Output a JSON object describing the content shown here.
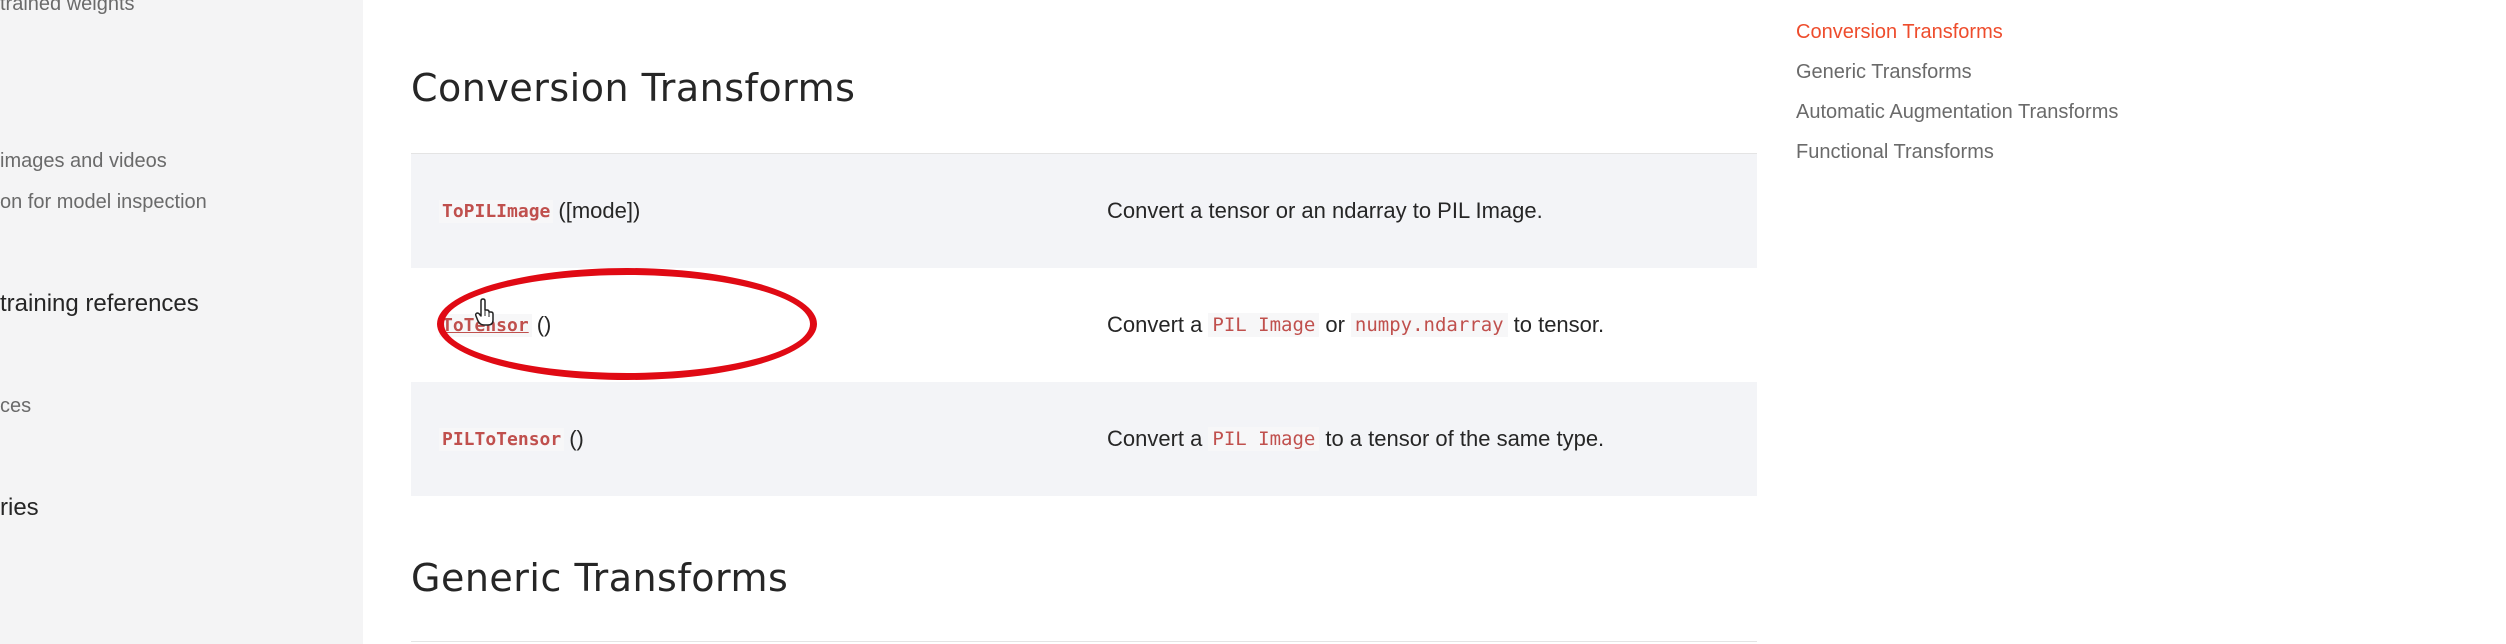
{
  "left_sidebar": {
    "items": [
      {
        "label": "trained weights"
      },
      {
        "label": "images and videos"
      },
      {
        "label": "on for model inspection"
      },
      {
        "label": "training references"
      },
      {
        "label": "ces"
      },
      {
        "label": "ries"
      }
    ]
  },
  "sections": {
    "conversion": {
      "heading": "Conversion Transforms",
      "rows": [
        {
          "class_name": "ToPILImage",
          "signature": "([mode])",
          "desc_parts": [
            "Convert a tensor or an ndarray to PIL Image."
          ]
        },
        {
          "class_name": "ToTensor",
          "signature": "()",
          "desc_parts": [
            "Convert a",
            "PIL Image",
            "or",
            "numpy.ndarray",
            "to tensor."
          ]
        },
        {
          "class_name": "PILToTensor",
          "signature": "()",
          "desc_parts": [
            "Convert a",
            "PIL Image",
            "to a tensor of the same type."
          ]
        }
      ]
    },
    "generic": {
      "heading": "Generic Transforms"
    }
  },
  "toc": {
    "items": [
      {
        "label": "Conversion Transforms",
        "active": true
      },
      {
        "label": "Generic Transforms",
        "active": false
      },
      {
        "label": "Automatic Augmentation Transforms",
        "active": false
      },
      {
        "label": "Functional Transforms",
        "active": false
      }
    ]
  },
  "colors": {
    "accent": "#ee4c2c",
    "code": "#c0504d",
    "annotation": "#e00a14",
    "row_shade": "#f3f4f7",
    "sidebar_bg": "#f4f4f5"
  }
}
